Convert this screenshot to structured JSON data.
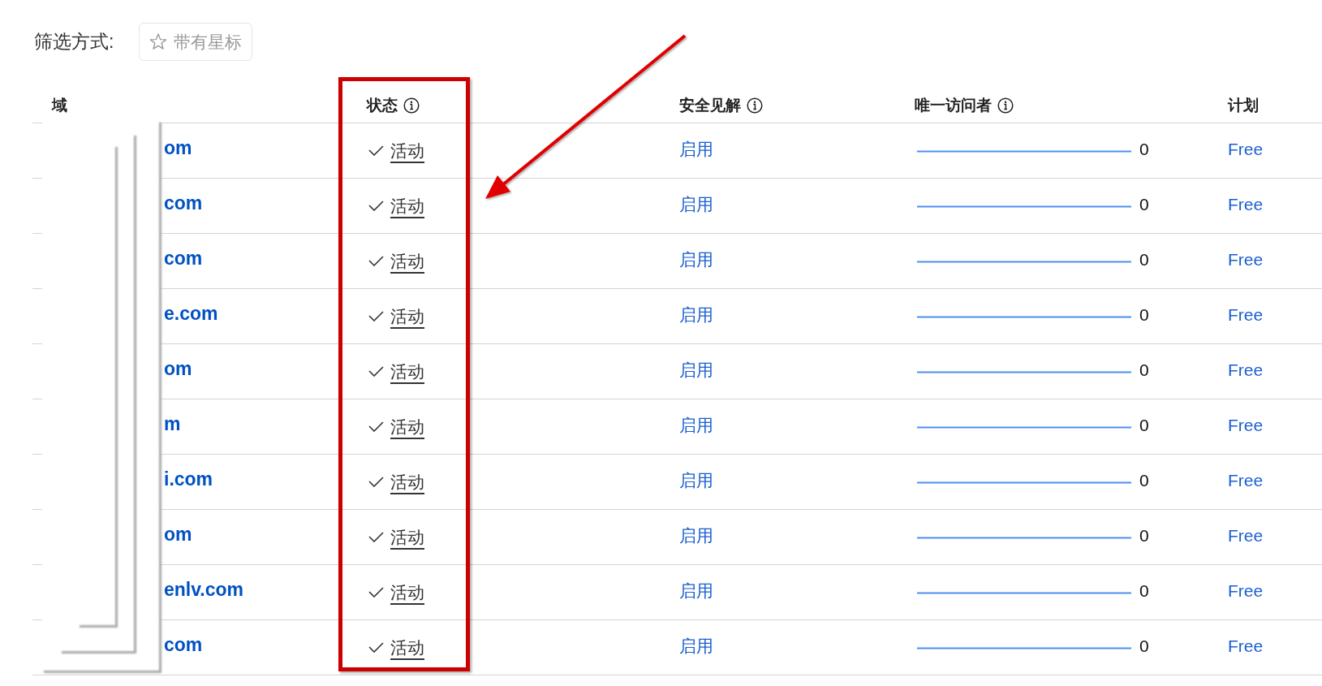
{
  "filter": {
    "label": "筛选方式:",
    "starred_button": {
      "label": "带有星标",
      "selected": false
    }
  },
  "table": {
    "columns": [
      {
        "label": "域",
        "info": false
      },
      {
        "label": "状态",
        "info": true
      },
      {
        "label": "安全见解",
        "info": true
      },
      {
        "label": "唯一访问者",
        "info": true
      },
      {
        "label": "计划",
        "info": false
      }
    ],
    "rows": [
      {
        "domain": "om",
        "status": "活动",
        "security_insights": "启用",
        "unique_visitors": "0",
        "plan": "Free"
      },
      {
        "domain": "com",
        "status": "活动",
        "security_insights": "启用",
        "unique_visitors": "0",
        "plan": "Free"
      },
      {
        "domain": "com",
        "status": "活动",
        "security_insights": "启用",
        "unique_visitors": "0",
        "plan": "Free"
      },
      {
        "domain": "e.com",
        "status": "活动",
        "security_insights": "启用",
        "unique_visitors": "0",
        "plan": "Free"
      },
      {
        "domain": "om",
        "status": "活动",
        "security_insights": "启用",
        "unique_visitors": "0",
        "plan": "Free"
      },
      {
        "domain": "m",
        "status": "活动",
        "security_insights": "启用",
        "unique_visitors": "0",
        "plan": "Free"
      },
      {
        "domain": "i.com",
        "status": "活动",
        "security_insights": "启用",
        "unique_visitors": "0",
        "plan": "Free"
      },
      {
        "domain": "om",
        "status": "活动",
        "security_insights": "启用",
        "unique_visitors": "0",
        "plan": "Free"
      },
      {
        "domain": "enlv.com",
        "status": "活动",
        "security_insights": "启用",
        "unique_visitors": "0",
        "plan": "Free"
      },
      {
        "domain": "com",
        "status": "活动",
        "security_insights": "启用",
        "unique_visitors": "0",
        "plan": "Free"
      }
    ]
  },
  "annotations": [
    {
      "kind": "redaction"
    },
    {
      "kind": "frame"
    },
    {
      "kind": "arrow"
    }
  ]
}
